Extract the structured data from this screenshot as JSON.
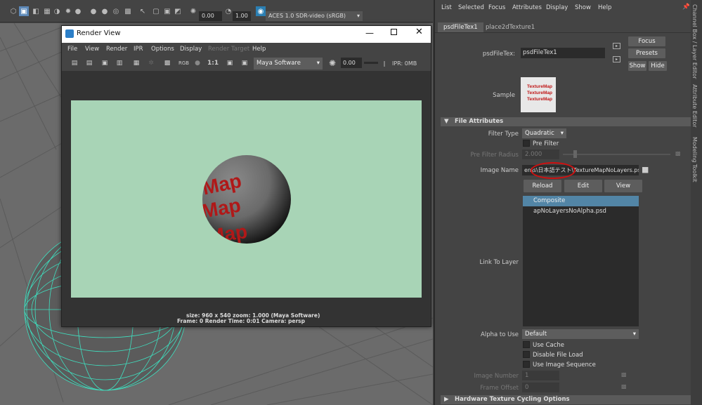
{
  "toolbar": {
    "exposure": "0.00",
    "gamma": "1.00",
    "color_space": "ACES 1.0 SDR-video (sRGB)"
  },
  "render_view": {
    "title": "Render View",
    "menus": [
      "File",
      "View",
      "Render",
      "IPR",
      "Options",
      "Display",
      "Render Target",
      "Help"
    ],
    "renderer": "Maya Software",
    "exposure": "0.00",
    "ratio": "1:1",
    "rgb": "RGB",
    "ipr_mem": "IPR: 0MB",
    "sphere_text": [
      "Map",
      "Map",
      "Map"
    ],
    "status_line1": "size: 960 x 540  zoom: 1.000        (Maya Software)",
    "status_line2": "Frame: 0      Render Time: 0:01          Camera: persp"
  },
  "attr_editor": {
    "menus": [
      "List",
      "Selected",
      "Focus",
      "Attributes",
      "Display",
      "Show",
      "Help"
    ],
    "tabs": [
      "psdFileTex1",
      "place2dTexture1"
    ],
    "node_label": "psdFileTex:",
    "node_value": "psdFileTex1",
    "focus": "Focus",
    "presets": "Presets",
    "show": "Show",
    "hide": "Hide",
    "sample_label": "Sample",
    "sample_text": [
      "TextureMap",
      "TextureMap",
      "TextureMap"
    ],
    "section_file": "File Attributes",
    "filter_type_label": "Filter Type",
    "filter_type": "Quadratic",
    "pre_filter": "Pre Filter",
    "pre_filter_radius_label": "Pre Filter Radius",
    "pre_filter_radius": "2.000",
    "image_name_label": "Image Name",
    "image_name": "en\\s\\日本語テスト\\TextureMapNoLayers.psd",
    "reload": "Reload",
    "edit": "Edit",
    "view": "View",
    "layers": [
      "Composite",
      "apNoLayersNoAlpha.psd"
    ],
    "link_label": "Link To Layer",
    "alpha_label": "Alpha to Use",
    "alpha": "Default",
    "use_cache": "Use Cache",
    "disable_load": "Disable File Load",
    "use_seq": "Use Image Sequence",
    "image_number_label": "Image Number",
    "image_number": "1",
    "frame_offset_label": "Frame Offset",
    "frame_offset": "0",
    "section_hw": "Hardware Texture Cycling Options"
  },
  "side_tabs": [
    "Channel Box / Layer Editor",
    "Attribute Editor",
    "Modeling Toolkit"
  ]
}
